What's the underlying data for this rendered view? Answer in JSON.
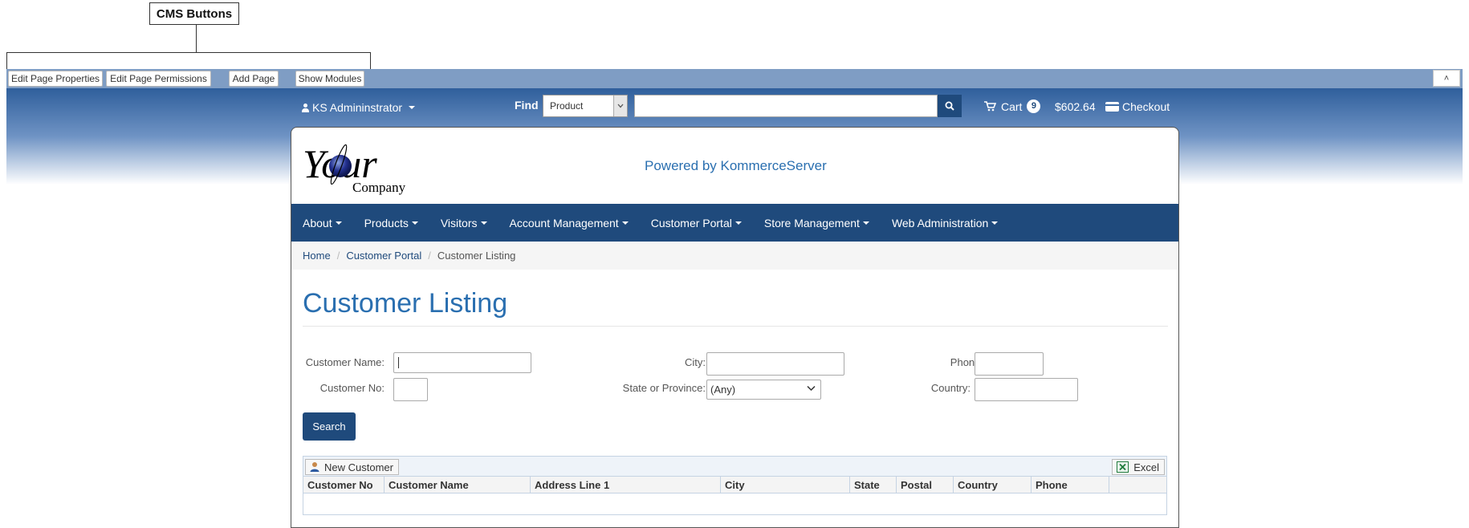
{
  "callout": {
    "label": "CMS Buttons"
  },
  "cms": {
    "buttons": [
      "Edit Page Properties",
      "Edit Page Permissions",
      "Add Page",
      "Show Modules"
    ],
    "collapse_glyph": "˄"
  },
  "topbar": {
    "user": "KS Admininstrator",
    "find_label": "Find",
    "find_select_value": "Product",
    "search_placeholder": "",
    "cart_label": "Cart",
    "cart_count": "9",
    "cart_total": "$602.64",
    "checkout_label": "Checkout"
  },
  "site": {
    "logo_text_top": "Your",
    "logo_text_bottom": "Company",
    "powered_by": "Powered by KommerceServer"
  },
  "nav": [
    "About",
    "Products",
    "Visitors",
    "Account Management",
    "Customer Portal",
    "Store Management",
    "Web Administration"
  ],
  "breadcrumb": [
    "Home",
    "Customer Portal",
    "Customer Listing"
  ],
  "page": {
    "title": "Customer Listing"
  },
  "filters": {
    "customer_name_label": "Customer Name:",
    "customer_no_label": "Customer No:",
    "city_label": "City:",
    "state_label": "State or Province:",
    "state_value": "(Any)",
    "phone_label": "Phone:",
    "country_label": "Country:",
    "search_button": "Search"
  },
  "grid": {
    "new_customer_label": "New Customer",
    "excel_label": "Excel",
    "columns": [
      "Customer No",
      "Customer Name",
      "Address Line 1",
      "City",
      "State",
      "Postal",
      "Country",
      "Phone",
      ""
    ]
  },
  "colors": {
    "brand_navy": "#1f4a7c",
    "title_blue": "#2a6fb0",
    "cms_bar": "#7f9dc4"
  }
}
